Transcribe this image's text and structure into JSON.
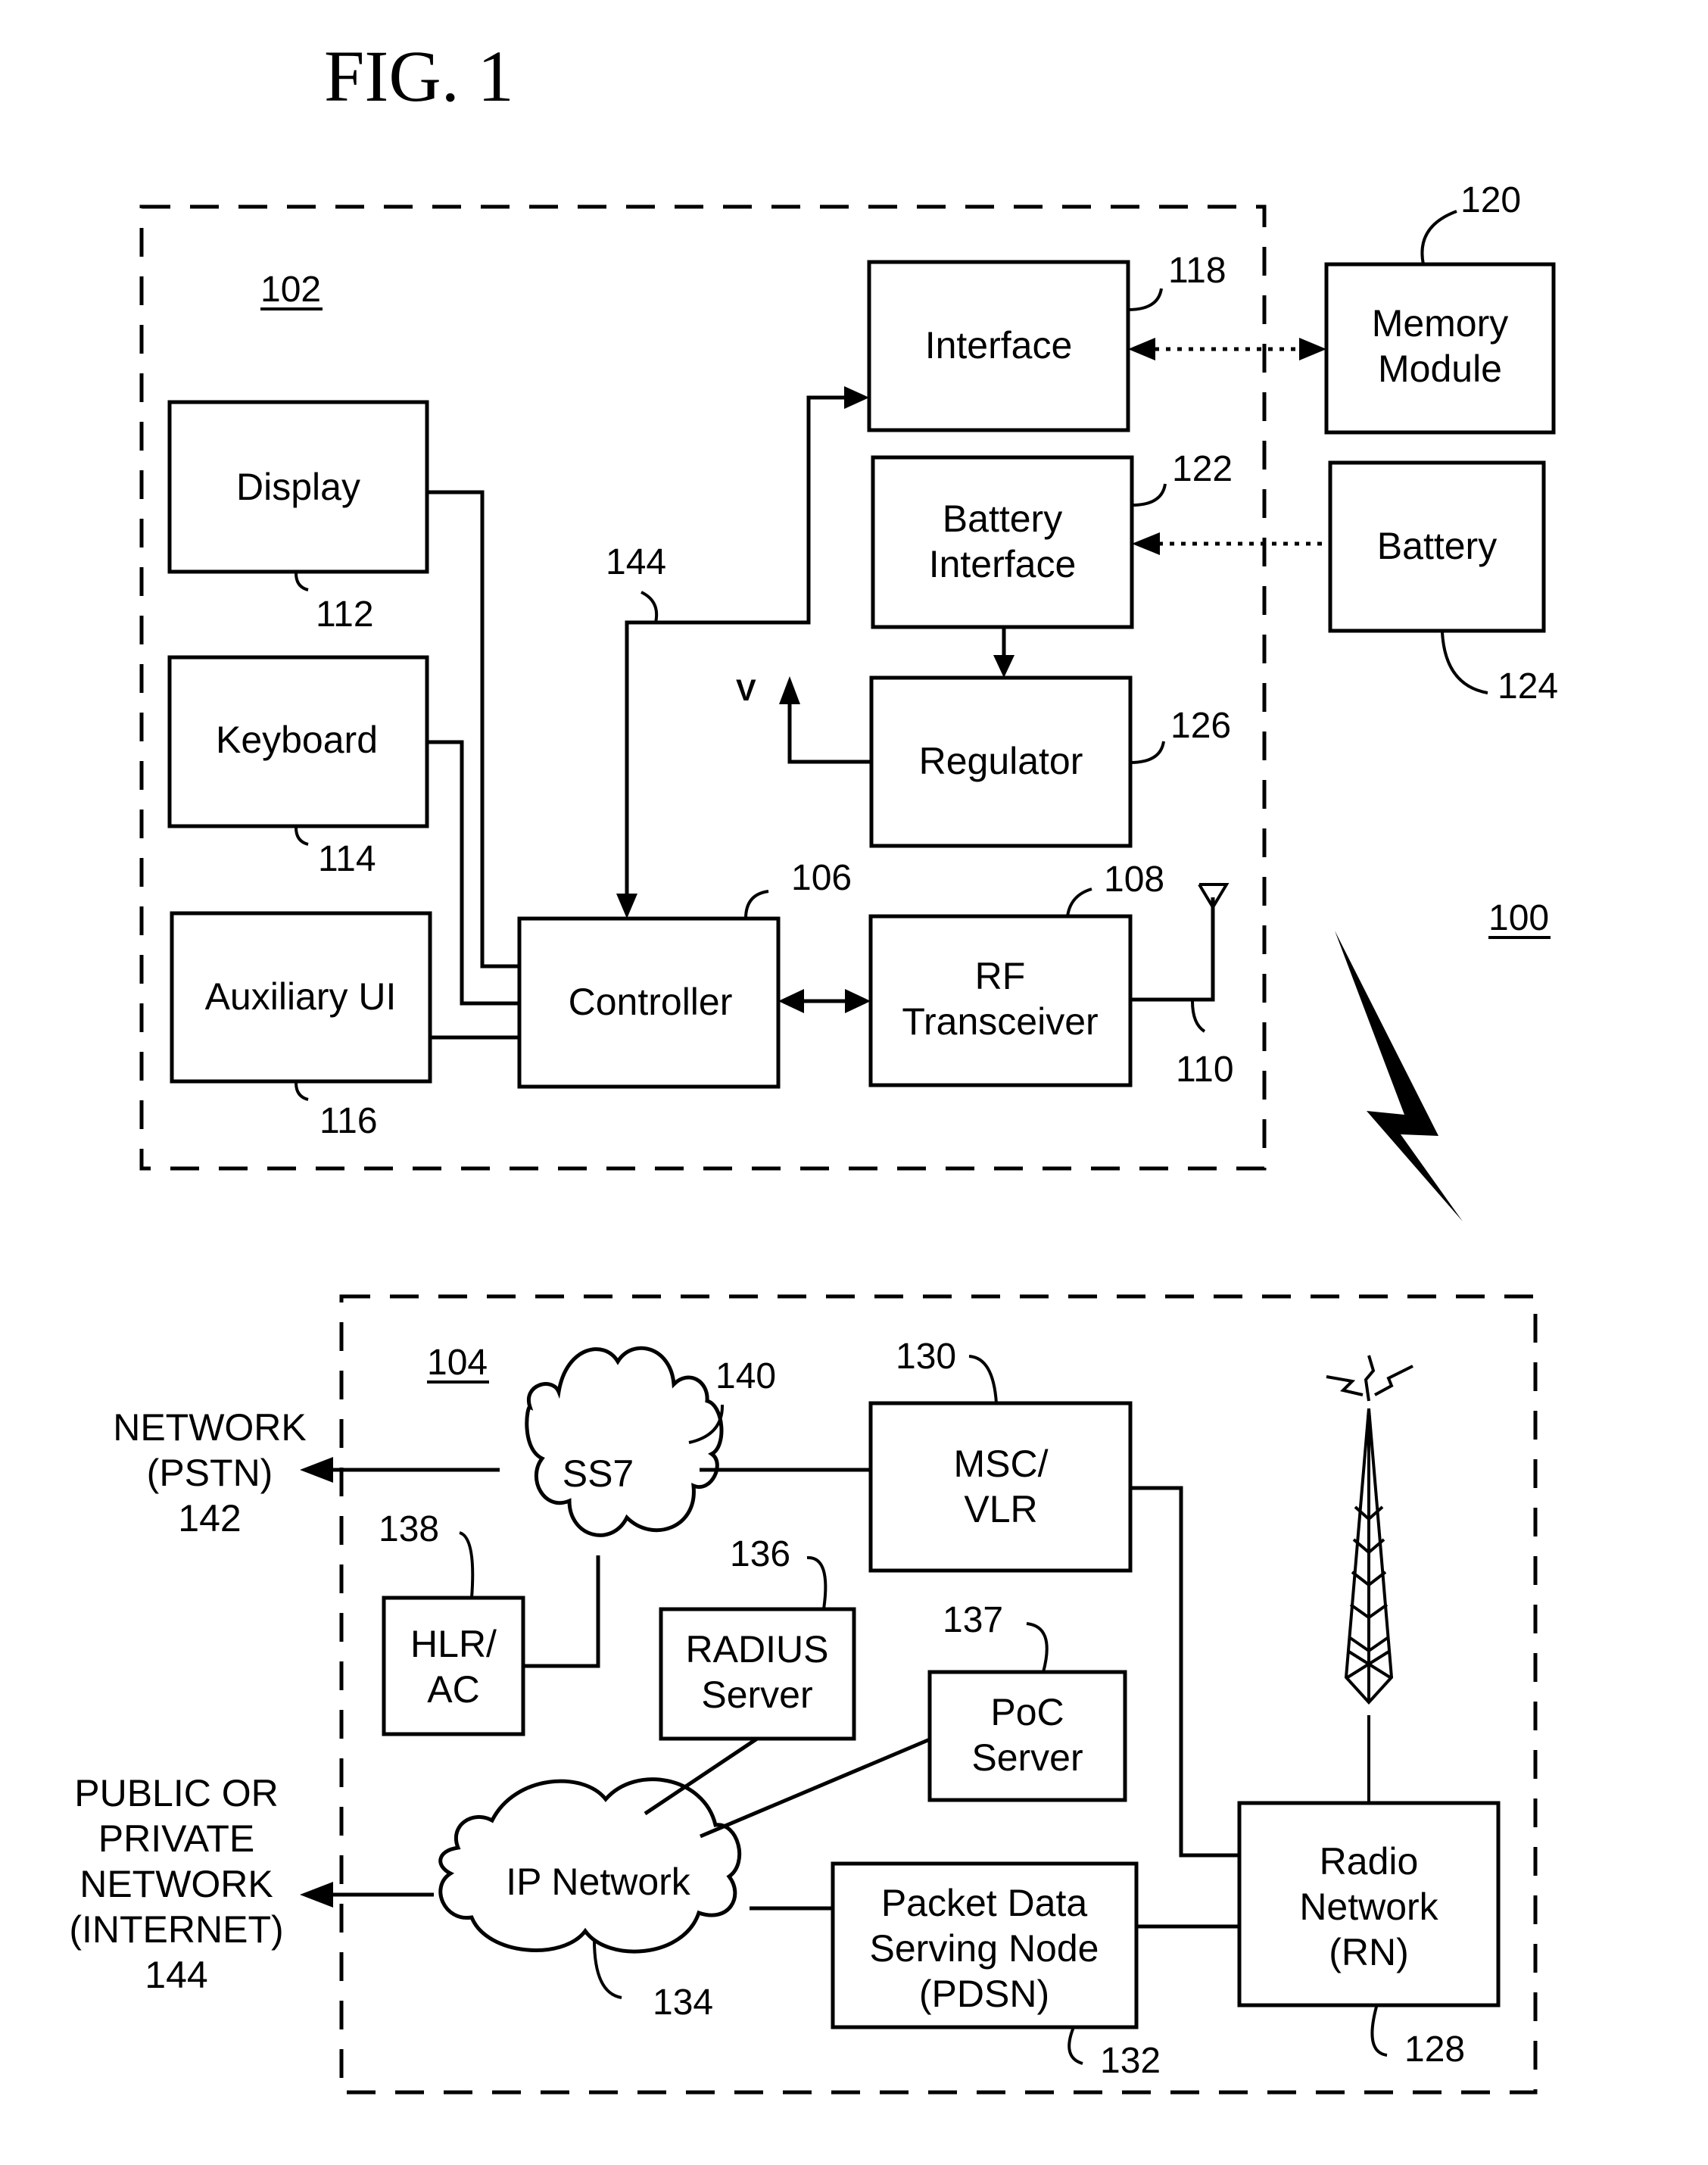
{
  "figure": {
    "title": "FIG. 1",
    "system_ref": "100"
  },
  "mobile_device": {
    "ref": "102",
    "bus_ref": "144",
    "voltage_label": "V",
    "antenna_ref": "110",
    "blocks": {
      "display": {
        "label": "Display",
        "ref": "112"
      },
      "keyboard": {
        "label": "Keyboard",
        "ref": "114"
      },
      "auxiliary_ui": {
        "label": "Auxiliary UI",
        "ref": "116"
      },
      "controller": {
        "label": "Controller",
        "ref": "106"
      },
      "interface": {
        "label": "Interface",
        "ref": "118"
      },
      "battery_interface": {
        "label_line1": "Battery",
        "label_line2": "Interface",
        "ref": "122"
      },
      "regulator": {
        "label": "Regulator",
        "ref": "126"
      },
      "rf_transceiver": {
        "label_line1": "RF",
        "label_line2": "Transceiver",
        "ref": "108"
      }
    }
  },
  "external": {
    "memory_module": {
      "label_line1": "Memory",
      "label_line2": "Module",
      "ref": "120"
    },
    "battery": {
      "label": "Battery",
      "ref": "124"
    }
  },
  "wireless_network": {
    "ref": "104",
    "blocks": {
      "ss7": {
        "label": "SS7",
        "ref": "140"
      },
      "msc_vlr": {
        "label_line1": "MSC/",
        "label_line2": "VLR",
        "ref": "130"
      },
      "hlr_ac": {
        "label_line1": "HLR/",
        "label_line2": "AC",
        "ref": "138"
      },
      "radius_server": {
        "label_line1": "RADIUS",
        "label_line2": "Server",
        "ref": "136"
      },
      "poc_server": {
        "label_line1": "PoC",
        "label_line2": "Server",
        "ref": "137"
      },
      "ip_network": {
        "label": "IP Network",
        "ref": "134"
      },
      "pdsn": {
        "label_line1": "Packet Data",
        "label_line2": "Serving Node",
        "label_line3": "(PDSN)",
        "ref": "132"
      },
      "radio_network": {
        "label_line1": "Radio",
        "label_line2": "Network",
        "label_line3": "(RN)",
        "ref": "128"
      }
    },
    "pstn": {
      "line1": "NETWORK",
      "line2": "(PSTN)",
      "ref": "142"
    },
    "internet": {
      "line1": "PUBLIC OR",
      "line2": "PRIVATE",
      "line3": "NETWORK",
      "line4": "(INTERNET)",
      "ref": "144"
    }
  }
}
